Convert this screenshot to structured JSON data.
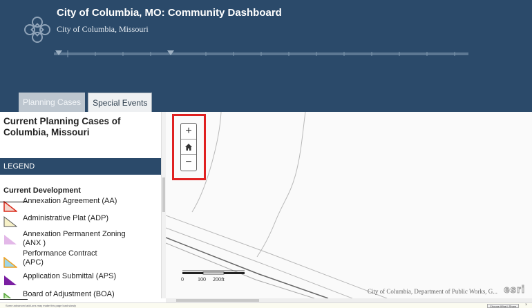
{
  "header": {
    "title": "City of Columbia, MO: Community Dashboard",
    "subtitle": "City of Columbia, Missouri"
  },
  "tabs": [
    {
      "label": "Planning Cases",
      "active": true
    },
    {
      "label": "Special Events",
      "active": false
    }
  ],
  "panel": {
    "title": "Current Planning Cases of Columbia, Missouri",
    "legend_header": "LEGEND",
    "section_title": "Current Development",
    "legend_items": [
      {
        "label": "Annexation Agreement (AA)",
        "fill": "#f5d6cc",
        "stroke": "#d9281a"
      },
      {
        "label": "Administrative Plat (ADP)",
        "fill": "#f7f1c8",
        "stroke": "#555555"
      },
      {
        "label": "Annexation Permanent Zoning (ANX )",
        "fill": "#e3b8e8",
        "stroke": "#e3b8e8"
      },
      {
        "label": "Performance Contract (APC)",
        "fill": "#9fd6e6",
        "stroke": "#f0a020"
      },
      {
        "label": "Application Submittal (APS)",
        "fill": "#7b1fa2",
        "stroke": "#7b1fa2"
      },
      {
        "label": "Board of Adjustment (BOA)",
        "fill": "#bfe6a8",
        "stroke": "#5aa640"
      }
    ]
  },
  "map": {
    "zoom_in": "+",
    "home_icon": "home-icon",
    "zoom_out": "−",
    "scale_labels": [
      "0",
      "100",
      "200ft"
    ],
    "attribution": "City of Columbia, Department of Public Works, G...",
    "esri_logo": "esri",
    "highlight_color": "#e02020"
  },
  "notification": {
    "text": "Some advanced add-ons may make this page load slowly",
    "button": "Choose What I Share"
  },
  "colors": {
    "header_bg": "#2b4a6a",
    "tab_active_bg": "#bdc6cf",
    "legend_bar_bg": "#2b4a6a"
  }
}
